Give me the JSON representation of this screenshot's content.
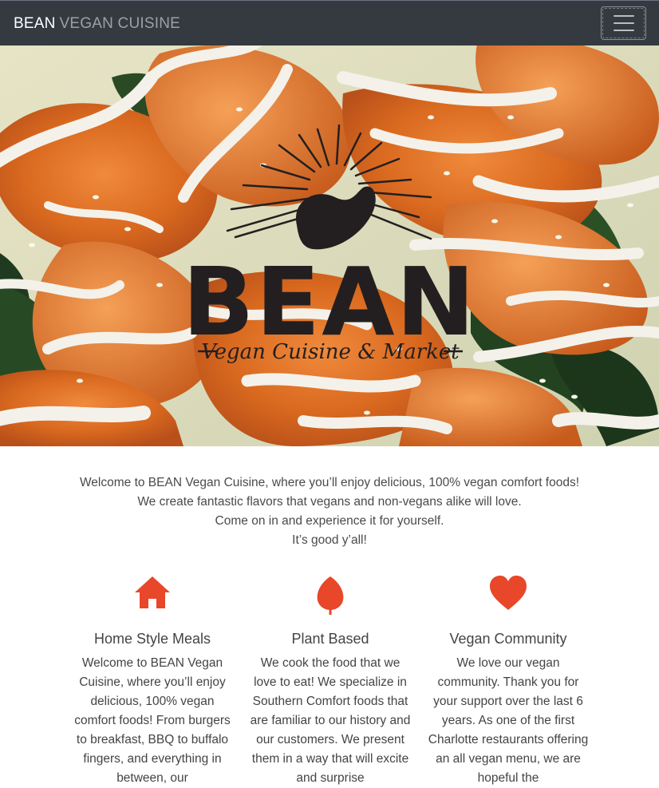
{
  "navbar": {
    "brand_bold": "BEAN",
    "brand_light": "VEGAN CUISINE",
    "toggle_label": "Toggle navigation"
  },
  "hero": {
    "logo_word": "BEAN",
    "logo_tagline": "Vegan Cuisine & Market"
  },
  "intro": {
    "lines": [
      "Welcome to BEAN Vegan Cuisine, where you’ll enjoy delicious, 100% vegan comfort foods!",
      "We create fantastic flavors that vegans and non-vegans alike will love.",
      "Come on in and experience it for yourself.",
      "It’s good y’all!"
    ]
  },
  "features": [
    {
      "icon": "home-icon",
      "title": "Home Style Meals",
      "text": "Welcome to BEAN Vegan Cuisine, where you’ll enjoy delicious, 100% vegan comfort foods! From burgers to breakfast, BBQ to buffalo fingers, and everything in between, our"
    },
    {
      "icon": "leaf-icon",
      "title": "Plant Based",
      "text": "We cook the food that we love to eat! We specialize in Southern Comfort foods that are familiar to our history and our customers. We present them in a way that will excite and surprise"
    },
    {
      "icon": "heart-icon",
      "title": "Vegan Community",
      "text": "We love our vegan community. Thank you for your support over the last 6 years. As one of the first Charlotte restaurants offering an all vegan menu, we are hopeful the"
    }
  ],
  "colors": {
    "navbar_bg": "#343a40",
    "accent": "#e8472a",
    "logo": "#231f20"
  }
}
